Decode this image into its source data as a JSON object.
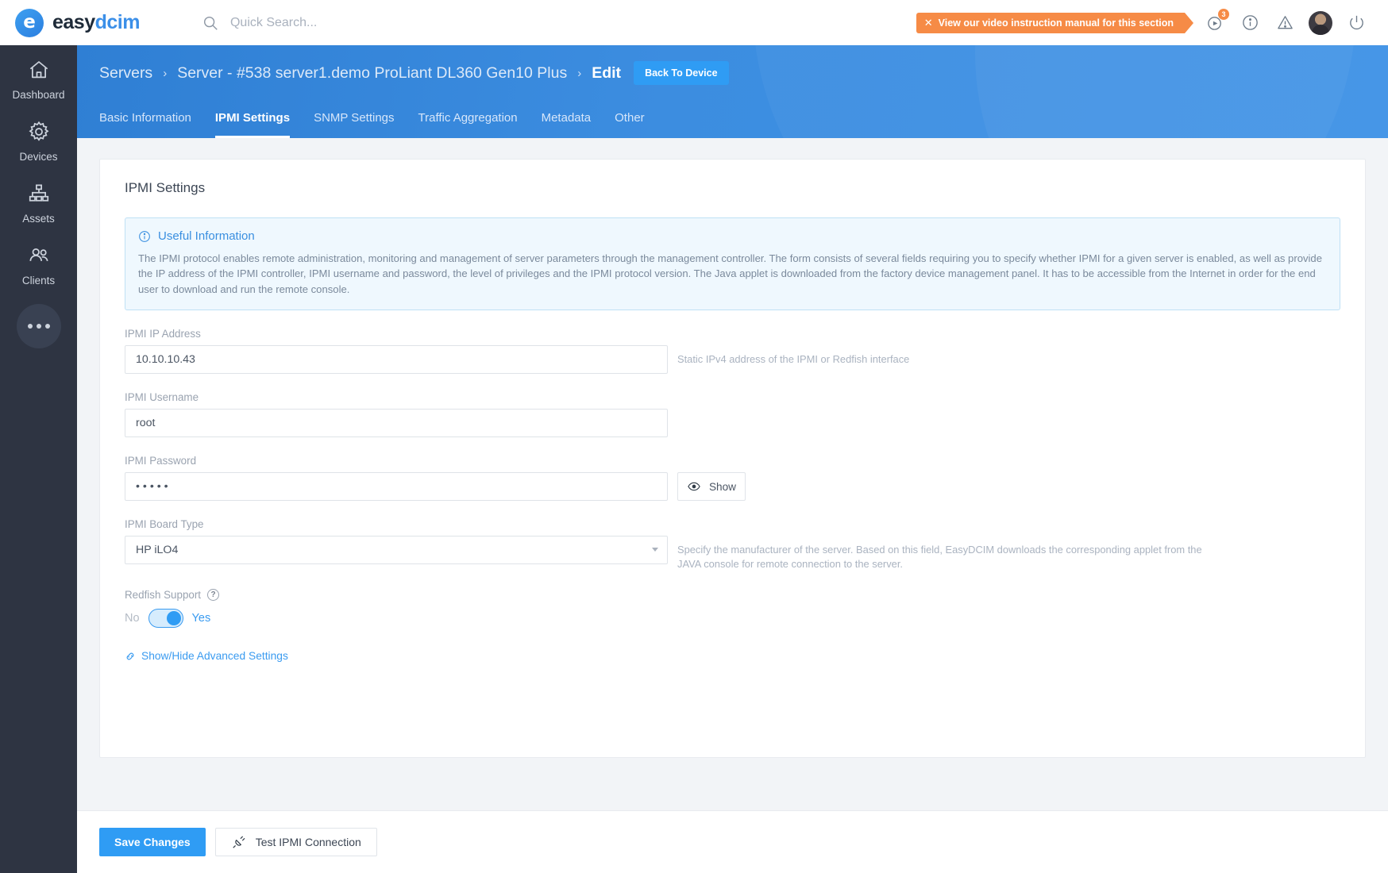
{
  "brand": {
    "easy": "easy",
    "dcim": "dcim",
    "mark": "e"
  },
  "search": {
    "placeholder": "Quick Search...",
    "icon": "search-icon"
  },
  "topbar": {
    "video_banner": {
      "close": "✕",
      "label": "View our video instruction manual for this section"
    },
    "play_badge": "3",
    "icons": [
      "play-circle-icon",
      "info-circle-icon",
      "warning-triangle-icon",
      "avatar",
      "power-icon"
    ]
  },
  "sidebar": {
    "items": [
      {
        "label": "Dashboard",
        "icon": "home-icon"
      },
      {
        "label": "Devices",
        "icon": "gear-icon"
      },
      {
        "label": "Assets",
        "icon": "sitemap-icon"
      },
      {
        "label": "Clients",
        "icon": "users-icon"
      }
    ],
    "more": "…"
  },
  "header": {
    "breadcrumb": [
      {
        "text": "Servers",
        "strong": false
      },
      {
        "text": "Server - #538 server1.demo ProLiant DL360 Gen10 Plus",
        "strong": false
      },
      {
        "text": "Edit",
        "strong": true
      }
    ],
    "separator": "›",
    "back_button": "Back To Device",
    "tabs": [
      {
        "label": "Basic Information",
        "active": false
      },
      {
        "label": "IPMI Settings",
        "active": true
      },
      {
        "label": "SNMP Settings",
        "active": false
      },
      {
        "label": "Traffic Aggregation",
        "active": false
      },
      {
        "label": "Metadata",
        "active": false
      },
      {
        "label": "Other",
        "active": false
      }
    ]
  },
  "card": {
    "title": "IPMI Settings",
    "info": {
      "title": "Useful Information",
      "icon": "info-circle-icon",
      "body": "The IPMI protocol enables remote administration, monitoring and management of server parameters through the management controller. The form consists of several fields requiring you to specify whether IPMI for a given server is enabled, as well as provide the IP address of the IPMI controller, IPMI username and password, the level of privileges and the IPMI protocol version. The Java applet is downloaded from the factory device management panel. It has to be accessible from the Internet in order for the end user to download and run the remote console."
    },
    "fields": {
      "ip": {
        "label": "IPMI IP Address",
        "value": "10.10.10.43",
        "placeholder": "IPMI IP Address",
        "helper": "Static IPv4 address of the IPMI or Redfish interface"
      },
      "username": {
        "label": "IPMI Username",
        "value": "root",
        "placeholder": "IPMI Username",
        "helper": ""
      },
      "password": {
        "label": "IPMI Password",
        "value": "• • • • •",
        "placeholder": "IPMI Password",
        "show_button": "Show",
        "show_icon": "eye-icon"
      },
      "board_type": {
        "label": "IPMI Board Type",
        "value": "HP iLO4",
        "options": [
          "HP iLO4"
        ],
        "helper": "Specify the manufacturer of the server. Based on this field, EasyDCIM downloads the corresponding applet from the JAVA console for remote connection to the server."
      },
      "redfish": {
        "label": "Redfish Support",
        "help_icon": "question-circle-icon",
        "off_label": "No",
        "on_label": "Yes",
        "state": "Yes"
      }
    },
    "advanced_link": {
      "label": "Show/Hide Advanced Settings",
      "icon": "link-icon"
    }
  },
  "footer": {
    "save_label": "Save Changes",
    "test_label": "Test IPMI Connection",
    "test_icon": "plug-icon"
  },
  "colors": {
    "accent": "#2f9cf4",
    "header_blue": "#3c8de0",
    "sidebar": "#2e3442",
    "banner_orange": "#f68b46",
    "info_bg": "#eff8fe",
    "info_border": "#bfe1f5"
  }
}
